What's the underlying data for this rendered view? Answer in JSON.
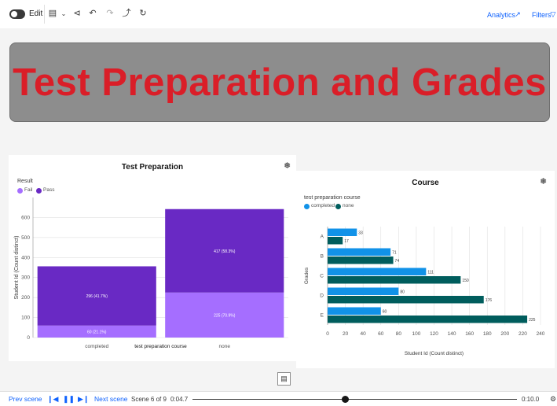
{
  "toolbar": {
    "edit_label": "Edit",
    "icons": [
      "document-icon",
      "chevron-down-icon",
      "share-icon",
      "undo-icon",
      "redo-icon",
      "pin-icon",
      "refresh-icon"
    ],
    "analytics_label": "Analytics",
    "filters_label": "Filters"
  },
  "banner": {
    "title": "Test Preparation and Grades",
    "title_color": "#da1e28",
    "background": "#8d8d8d"
  },
  "left_panel": {
    "title": "Test Preparation",
    "legend_title": "Result",
    "legend": [
      {
        "label": "Fail",
        "color": "#a56eff"
      },
      {
        "label": "Pass",
        "color": "#6929c4"
      }
    ],
    "chart_data": {
      "type": "bar",
      "stacked": true,
      "title": "Test Preparation",
      "xlabel": "test preparation course",
      "ylabel": "Student Id (Count distinct)",
      "categories": [
        "completed",
        "none"
      ],
      "series": [
        {
          "name": "Fail",
          "color": "#a56eff",
          "values": [
            60,
            225
          ],
          "labels": [
            "60 (21.1%)",
            "225 (70.9%)"
          ]
        },
        {
          "name": "Pass",
          "color": "#6929c4",
          "values": [
            296,
            417
          ],
          "labels": [
            "296 (41.7%)",
            "417 (58.3%)"
          ]
        }
      ],
      "ylim": [
        0,
        700
      ],
      "yticks": [
        0,
        100,
        200,
        300,
        400,
        500,
        600
      ],
      "grid": true,
      "legend_position": "top-left"
    }
  },
  "right_panel": {
    "title": "Course",
    "legend_title": "test preparation course",
    "legend": [
      {
        "label": "completed",
        "color": "#1192e8"
      },
      {
        "label": "none",
        "color": "#005d5d"
      }
    ],
    "chart_data": {
      "type": "bar",
      "orientation": "horizontal",
      "title": "Course",
      "xlabel": "Student Id (Count distinct)",
      "ylabel": "Grades",
      "categories": [
        "A",
        "B",
        "C",
        "D",
        "E"
      ],
      "series": [
        {
          "name": "completed",
          "color": "#1192e8",
          "values": [
            33,
            71,
            111,
            80,
            60
          ]
        },
        {
          "name": "none",
          "color": "#005d5d",
          "values": [
            17,
            74,
            150,
            176,
            225
          ]
        }
      ],
      "xlim": [
        0,
        240
      ],
      "xticks": [
        0,
        20,
        40,
        60,
        80,
        100,
        120,
        140,
        160,
        180,
        200,
        220,
        240
      ],
      "grid": true,
      "legend_position": "top-left"
    }
  },
  "bottombar": {
    "prev_scene": "Prev scene",
    "next_scene": "Next scene",
    "scene_label": "Scene 6 of 9",
    "current_time": "0:04.7",
    "total_time": "0:10.0",
    "progress": 0.47
  }
}
